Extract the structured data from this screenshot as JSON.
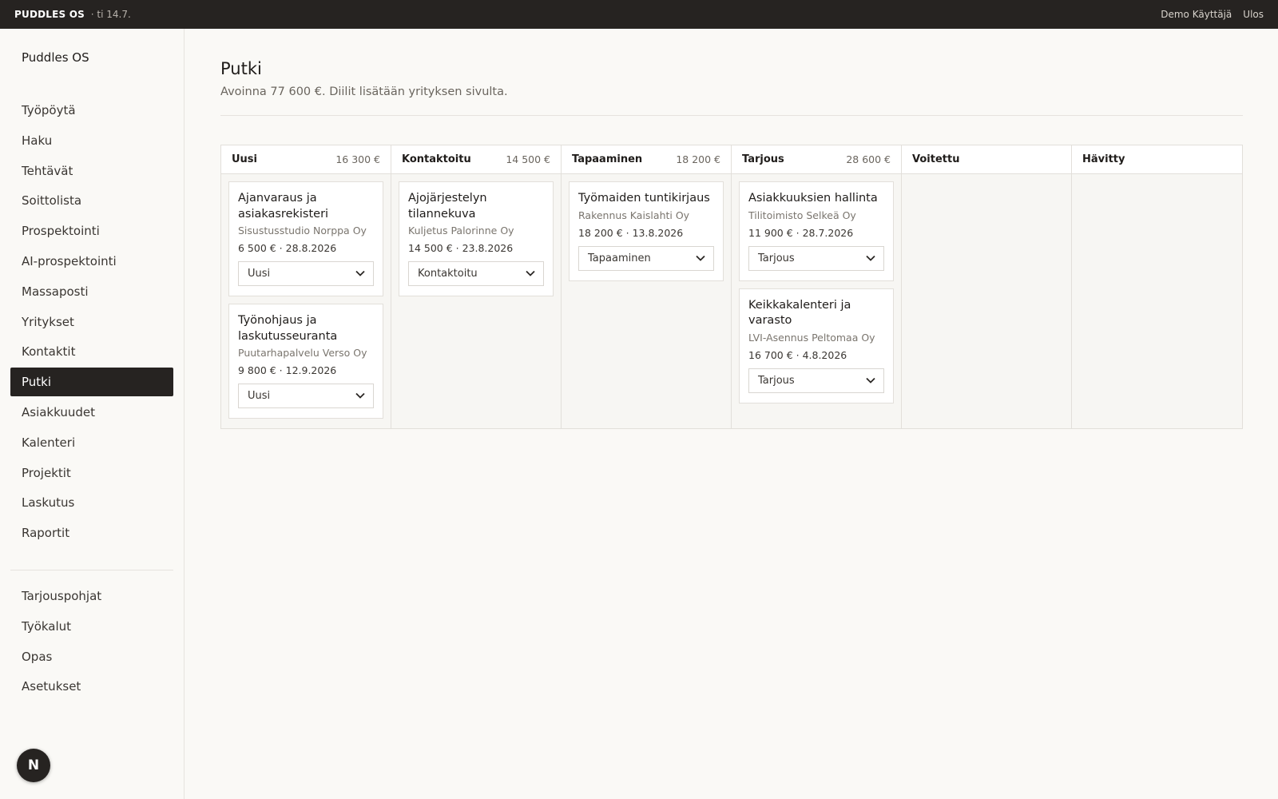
{
  "topbar": {
    "brand": "PUDDLES OS",
    "date": "· ti 14.7.",
    "user": "Demo Käyttäjä",
    "logout": "Ulos"
  },
  "sidebar": {
    "app_title": "Puddles OS",
    "items": [
      {
        "label": "Työpöytä",
        "active": false
      },
      {
        "label": "Haku",
        "active": false
      },
      {
        "label": "Tehtävät",
        "active": false
      },
      {
        "label": "Soittolista",
        "active": false
      },
      {
        "label": "Prospektointi",
        "active": false
      },
      {
        "label": "AI-prospektointi",
        "active": false
      },
      {
        "label": "Massaposti",
        "active": false
      },
      {
        "label": "Yritykset",
        "active": false
      },
      {
        "label": "Kontaktit",
        "active": false
      },
      {
        "label": "Putki",
        "active": true
      },
      {
        "label": "Asiakkuudet",
        "active": false
      },
      {
        "label": "Kalenteri",
        "active": false
      },
      {
        "label": "Projektit",
        "active": false
      },
      {
        "label": "Laskutus",
        "active": false
      },
      {
        "label": "Raportit",
        "active": false
      }
    ],
    "secondary_items": [
      {
        "label": "Tarjouspohjat"
      },
      {
        "label": "Työkalut"
      },
      {
        "label": "Opas"
      },
      {
        "label": "Asetukset"
      }
    ],
    "fab_icon": "next-logo-icon",
    "fab_letter": "N"
  },
  "main": {
    "title": "Putki",
    "subtitle": "Avoinna 77 600 €. Diilit lisätään yrityksen sivulta.",
    "columns": [
      {
        "name": "Uusi",
        "total": "16 300 €",
        "cards": [
          {
            "title": "Ajanvaraus ja asiakasrekisteri",
            "company": "Sisustusstudio Norppa Oy",
            "meta": "6 500 € · 28.8.2026",
            "stage": "Uusi"
          },
          {
            "title": "Työnohjaus ja laskutusseuranta",
            "company": "Puutarhapalvelu Verso Oy",
            "meta": "9 800 € · 12.9.2026",
            "stage": "Uusi"
          }
        ]
      },
      {
        "name": "Kontaktoitu",
        "total": "14 500 €",
        "cards": [
          {
            "title": "Ajojärjestelyn tilannekuva",
            "company": "Kuljetus Palorinne Oy",
            "meta": "14 500 € · 23.8.2026",
            "stage": "Kontaktoitu"
          }
        ]
      },
      {
        "name": "Tapaaminen",
        "total": "18 200 €",
        "cards": [
          {
            "title": "Työmaiden tuntikirjaus",
            "company": "Rakennus Kaislahti Oy",
            "meta": "18 200 € · 13.8.2026",
            "stage": "Tapaaminen"
          }
        ]
      },
      {
        "name": "Tarjous",
        "total": "28 600 €",
        "cards": [
          {
            "title": "Asiakkuuksien hallinta",
            "company": "Tilitoimisto Selkeä Oy",
            "meta": "11 900 € · 28.7.2026",
            "stage": "Tarjous"
          },
          {
            "title": "Keikkakalenteri ja varasto",
            "company": "LVI-Asennus Peltomaa Oy",
            "meta": "16 700 € · 4.8.2026",
            "stage": "Tarjous"
          }
        ]
      },
      {
        "name": "Voitettu",
        "total": "",
        "cards": []
      },
      {
        "name": "Hävitty",
        "total": "",
        "cards": []
      }
    ]
  },
  "colors": {
    "topbar_bg": "#262321",
    "active_nav_bg": "#262321",
    "page_bg": "#faf9f6"
  }
}
